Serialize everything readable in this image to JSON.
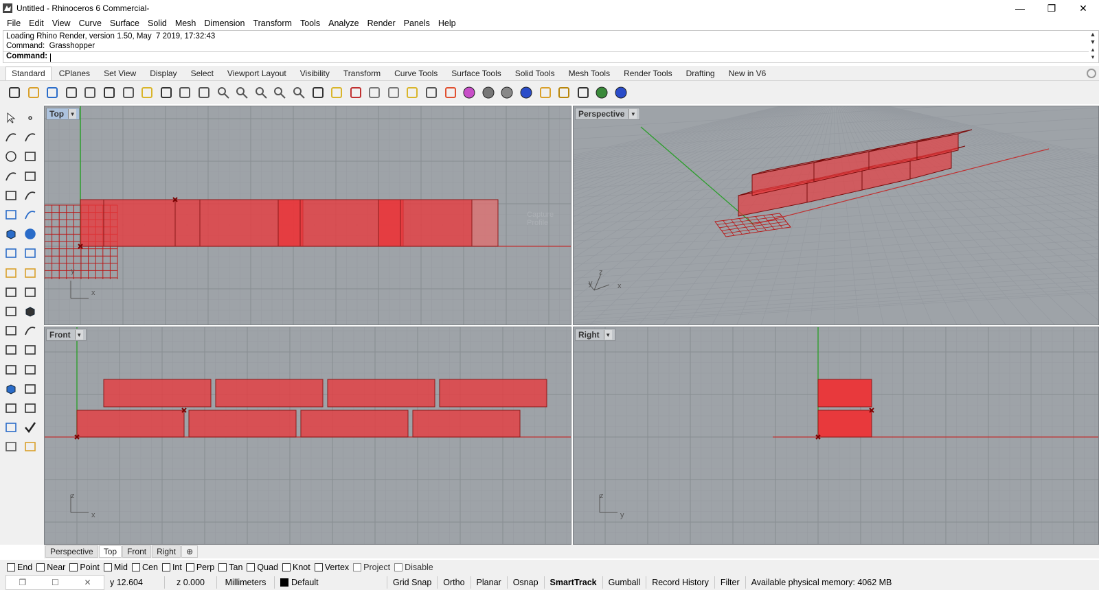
{
  "window": {
    "title": "Untitled - Rhinoceros 6 Commercial-",
    "minimize": "—",
    "maximize": "❐",
    "close": "✕"
  },
  "menu": [
    "File",
    "Edit",
    "View",
    "Curve",
    "Surface",
    "Solid",
    "Mesh",
    "Dimension",
    "Transform",
    "Tools",
    "Analyze",
    "Render",
    "Panels",
    "Help"
  ],
  "command": {
    "history1": "Loading Rhino Render, version 1.50, May  7 2019, 17:32:43",
    "history2": "Command:  Grasshopper",
    "prompt": "Command:",
    "value": ""
  },
  "toolbar_tabs": [
    "Standard",
    "CPlanes",
    "Set View",
    "Display",
    "Select",
    "Viewport Layout",
    "Visibility",
    "Transform",
    "Curve Tools",
    "Surface Tools",
    "Solid Tools",
    "Mesh Tools",
    "Render Tools",
    "Drafting",
    "New in V6"
  ],
  "toolbar_icons": [
    "new-file-icon",
    "open-file-icon",
    "save-icon",
    "print-icon",
    "import-icon",
    "cut-icon",
    "copy-icon",
    "paste-icon",
    "undo-icon",
    "pan-icon",
    "rotate-view-icon",
    "zoom-icon",
    "zoom-window-icon",
    "zoom-extents-icon",
    "zoom-selected-icon",
    "zoom-dynamic-icon",
    "four-viewports-icon",
    "named-cplane-icon",
    "hide-icon",
    "show-icon",
    "snapshot-icon",
    "light-icon",
    "lock-icon",
    "layer-icon",
    "color-wheel-icon",
    "shaded-sphere-icon",
    "rendered-sphere-icon",
    "render-sphere-icon",
    "gradient-icon",
    "options-gear-icon",
    "curve-tools-icon",
    "grasshopper-icon",
    "help-icon"
  ],
  "viewports": {
    "top": {
      "label": "Top",
      "axis_x": "x",
      "axis_y": "y",
      "ghost_text": "Capture Profile"
    },
    "perspective": {
      "label": "Perspective",
      "axis_x": "x",
      "axis_y": "y",
      "axis_z": "z"
    },
    "front": {
      "label": "Front",
      "axis_x": "x",
      "axis_z": "z"
    },
    "right": {
      "label": "Right",
      "axis_y": "y",
      "axis_z": "z"
    }
  },
  "viewport_tabs": [
    "Perspective",
    "Top",
    "Front",
    "Right"
  ],
  "viewport_tab_add": "⊕",
  "osnaps": [
    {
      "label": "End",
      "checked": false
    },
    {
      "label": "Near",
      "checked": false
    },
    {
      "label": "Point",
      "checked": false
    },
    {
      "label": "Mid",
      "checked": false
    },
    {
      "label": "Cen",
      "checked": false
    },
    {
      "label": "Int",
      "checked": false
    },
    {
      "label": "Perp",
      "checked": false
    },
    {
      "label": "Tan",
      "checked": false
    },
    {
      "label": "Quad",
      "checked": false
    },
    {
      "label": "Knot",
      "checked": false
    },
    {
      "label": "Vertex",
      "checked": false
    },
    {
      "label": "Project",
      "checked": false
    },
    {
      "label": "Disable",
      "checked": false
    }
  ],
  "status": {
    "y": "y 12.604",
    "z": "z 0.000",
    "units": "Millimeters",
    "layer": "Default",
    "toggles": [
      "Grid Snap",
      "Ortho",
      "Planar",
      "Osnap",
      "SmartTrack",
      "Gumball",
      "Record History",
      "Filter"
    ],
    "active_toggle": "SmartTrack",
    "memory": "Available physical memory: 4062 MB"
  },
  "colors": {
    "brick": "#e8393c",
    "viewport_bg": "#9ea3a8",
    "grid": "#8c9196",
    "x_axis": "#c03030",
    "y_axis": "#2e9e2e"
  }
}
